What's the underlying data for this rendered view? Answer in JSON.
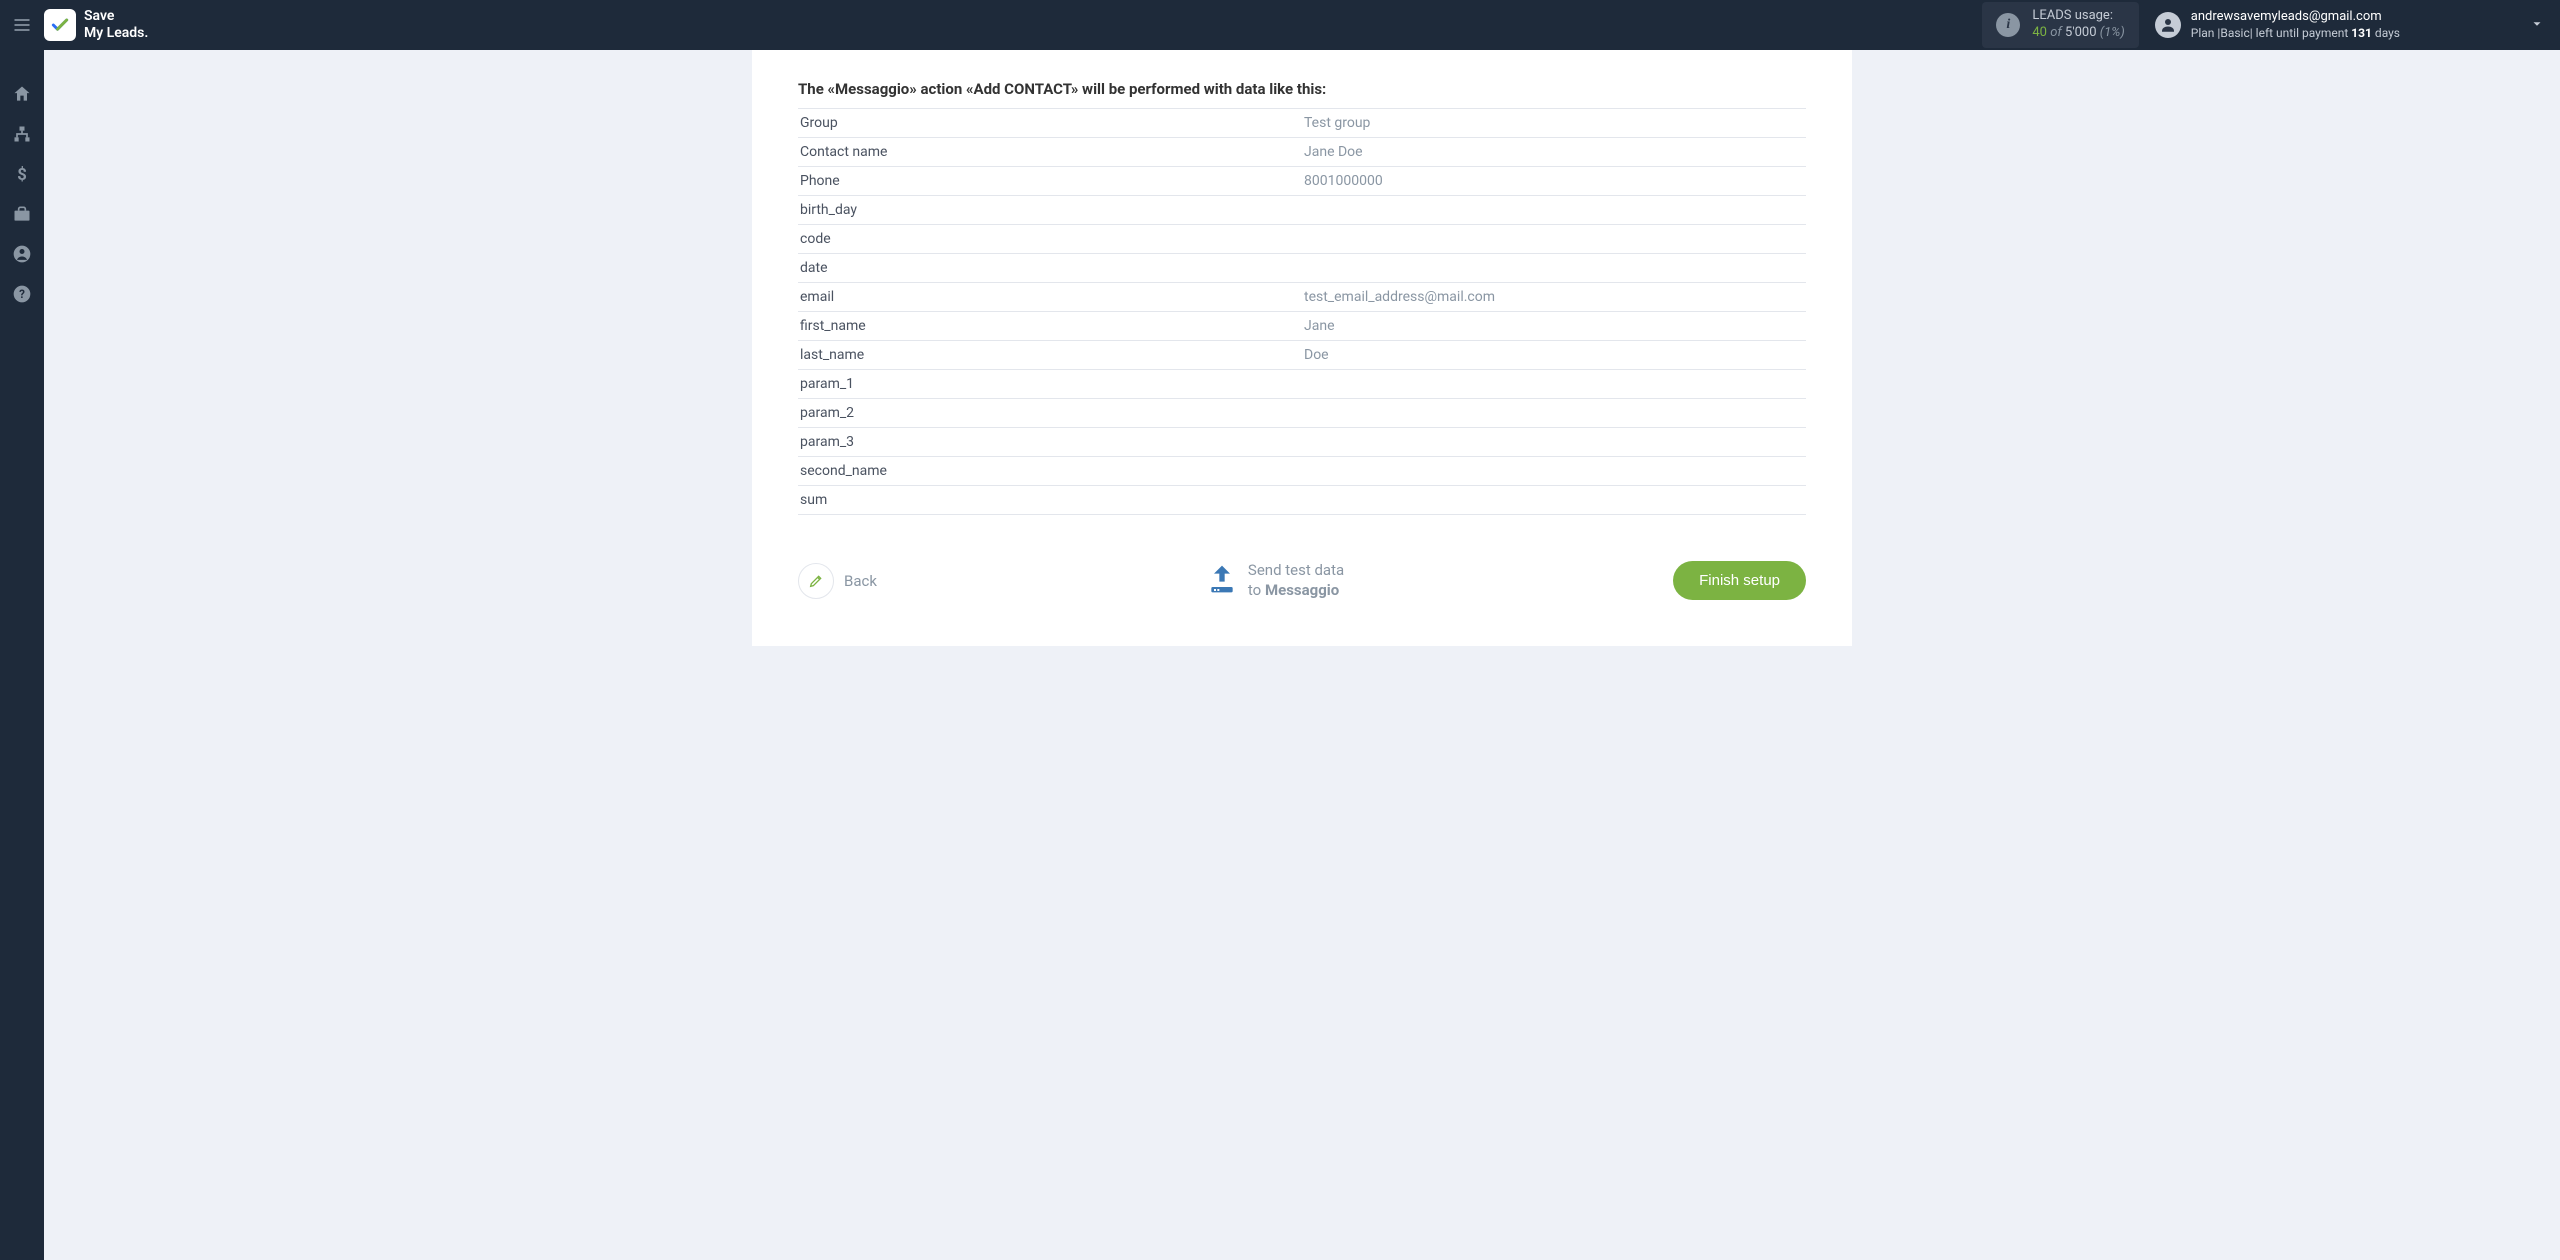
{
  "header": {
    "logo_line1": "Save",
    "logo_line2": "My Leads.",
    "usage": {
      "label": "LEADS usage:",
      "current": "40",
      "of": "of",
      "total": "5'000",
      "percent": "(1%)"
    },
    "user": {
      "email": "andrewsavemyleads@gmail.com",
      "plan_prefix": "Plan |",
      "plan_name": "Basic",
      "plan_suffix": "| left until payment",
      "days_count": "131",
      "days_label": "days"
    }
  },
  "content": {
    "heading": "The «Messaggio» action «Add CONTACT» will be performed with data like this:",
    "rows": [
      {
        "label": "Group",
        "value": "Test group"
      },
      {
        "label": "Contact name",
        "value": "Jane Doe"
      },
      {
        "label": "Phone",
        "value": "8001000000"
      },
      {
        "label": "birth_day",
        "value": ""
      },
      {
        "label": "code",
        "value": ""
      },
      {
        "label": "date",
        "value": ""
      },
      {
        "label": "email",
        "value": "test_email_address@mail.com"
      },
      {
        "label": "first_name",
        "value": "Jane"
      },
      {
        "label": "last_name",
        "value": "Doe"
      },
      {
        "label": "param_1",
        "value": ""
      },
      {
        "label": "param_2",
        "value": ""
      },
      {
        "label": "param_3",
        "value": ""
      },
      {
        "label": "second_name",
        "value": ""
      },
      {
        "label": "sum",
        "value": ""
      }
    ]
  },
  "actions": {
    "back_label": "Back",
    "send_line1": "Send test data",
    "send_line2_prefix": "to",
    "send_line2_target": "Messaggio",
    "finish_label": "Finish setup"
  }
}
